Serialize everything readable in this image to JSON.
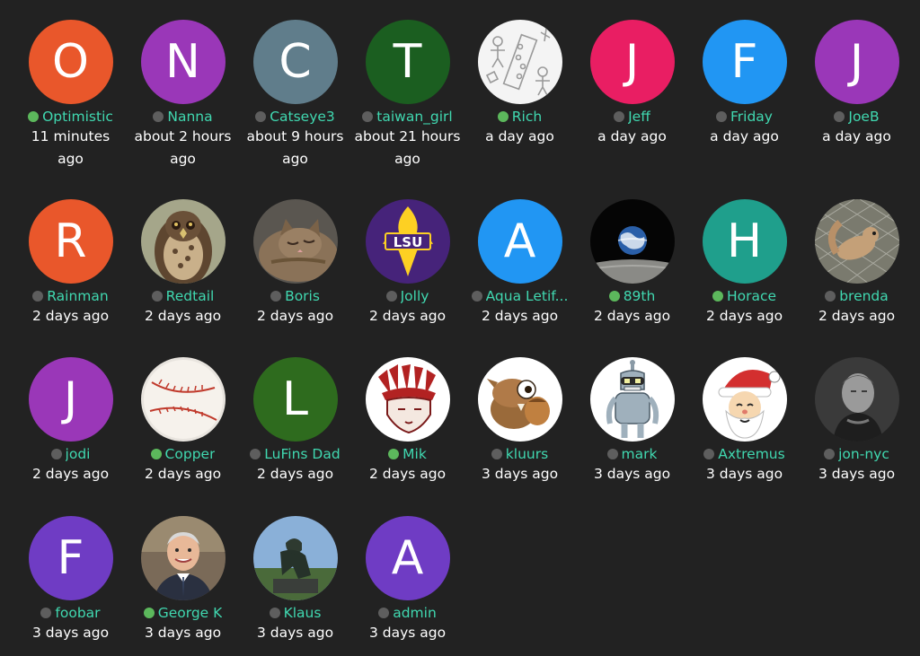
{
  "users": [
    {
      "name": "Optimistic",
      "time": "11 minutes ago",
      "online": true,
      "avatar": {
        "type": "letter",
        "letter": "O",
        "color": "#e9572b"
      }
    },
    {
      "name": "Nanna",
      "time": "about 2 hours ago",
      "online": false,
      "avatar": {
        "type": "letter",
        "letter": "N",
        "color": "#9a37b8"
      }
    },
    {
      "name": "Catseye3",
      "time": "about 9 hours ago",
      "online": false,
      "avatar": {
        "type": "letter",
        "letter": "C",
        "color": "#607d8b"
      }
    },
    {
      "name": "taiwan_girl",
      "time": "about 21 hours ago",
      "online": false,
      "avatar": {
        "type": "letter",
        "letter": "T",
        "color": "#1b5e20"
      }
    },
    {
      "name": "Rich",
      "time": "a day ago",
      "online": true,
      "avatar": {
        "type": "image",
        "icon": "doodle-sketch-icon"
      }
    },
    {
      "name": "Jeff",
      "time": "a day ago",
      "online": false,
      "avatar": {
        "type": "letter",
        "letter": "J",
        "color": "#e91e63"
      }
    },
    {
      "name": "Friday",
      "time": "a day ago",
      "online": false,
      "avatar": {
        "type": "letter",
        "letter": "F",
        "color": "#2196f3"
      }
    },
    {
      "name": "JoeB",
      "time": "a day ago",
      "online": false,
      "avatar": {
        "type": "letter",
        "letter": "J",
        "color": "#9a37b8"
      }
    },
    {
      "name": "Rainman",
      "time": "2 days ago",
      "online": false,
      "avatar": {
        "type": "letter",
        "letter": "R",
        "color": "#e9572b"
      }
    },
    {
      "name": "Redtail",
      "time": "2 days ago",
      "online": false,
      "avatar": {
        "type": "image",
        "icon": "hawk-photo-icon"
      }
    },
    {
      "name": "Boris",
      "time": "2 days ago",
      "online": false,
      "avatar": {
        "type": "image",
        "icon": "cat-photo-icon"
      }
    },
    {
      "name": "Jolly",
      "time": "2 days ago",
      "online": false,
      "avatar": {
        "type": "image",
        "icon": "lsu-logo-icon"
      }
    },
    {
      "name": "Aqua Letif...",
      "time": "2 days ago",
      "online": false,
      "avatar": {
        "type": "letter",
        "letter": "A",
        "color": "#2196f3"
      }
    },
    {
      "name": "89th",
      "time": "2 days ago",
      "online": true,
      "avatar": {
        "type": "image",
        "icon": "earthrise-photo-icon"
      }
    },
    {
      "name": "Horace",
      "time": "2 days ago",
      "online": true,
      "avatar": {
        "type": "letter",
        "letter": "H",
        "color": "#1f9f8c"
      }
    },
    {
      "name": "brenda",
      "time": "2 days ago",
      "online": false,
      "avatar": {
        "type": "image",
        "icon": "squirrel-photo-icon"
      }
    },
    {
      "name": "jodi",
      "time": "2 days ago",
      "online": false,
      "avatar": {
        "type": "letter",
        "letter": "J",
        "color": "#9a37b8"
      }
    },
    {
      "name": "Copper",
      "time": "2 days ago",
      "online": true,
      "avatar": {
        "type": "image",
        "icon": "baseball-icon"
      }
    },
    {
      "name": "LuFins Dad",
      "time": "2 days ago",
      "online": false,
      "avatar": {
        "type": "letter",
        "letter": "L",
        "color": "#2e6b1e"
      }
    },
    {
      "name": "Mik",
      "time": "2 days ago",
      "online": true,
      "avatar": {
        "type": "image",
        "icon": "headdress-logo-icon"
      }
    },
    {
      "name": "kluurs",
      "time": "3 days ago",
      "online": false,
      "avatar": {
        "type": "image",
        "icon": "scrat-squirrel-icon"
      }
    },
    {
      "name": "mark",
      "time": "3 days ago",
      "online": false,
      "avatar": {
        "type": "image",
        "icon": "bender-robot-icon"
      }
    },
    {
      "name": "Axtremus",
      "time": "3 days ago",
      "online": false,
      "avatar": {
        "type": "image",
        "icon": "santa-face-icon"
      }
    },
    {
      "name": "jon-nyc",
      "time": "3 days ago",
      "online": false,
      "avatar": {
        "type": "image",
        "icon": "portrait-photo-icon"
      }
    },
    {
      "name": "foobar",
      "time": "3 days ago",
      "online": false,
      "avatar": {
        "type": "letter",
        "letter": "F",
        "color": "#6f3cc4"
      }
    },
    {
      "name": "George K",
      "time": "3 days ago",
      "online": true,
      "avatar": {
        "type": "image",
        "icon": "man-portrait-icon"
      }
    },
    {
      "name": "Klaus",
      "time": "3 days ago",
      "online": false,
      "avatar": {
        "type": "image",
        "icon": "thinker-statue-icon"
      }
    },
    {
      "name": "admin",
      "time": "3 days ago",
      "online": false,
      "avatar": {
        "type": "letter",
        "letter": "A",
        "color": "#6f3cc4"
      }
    }
  ]
}
